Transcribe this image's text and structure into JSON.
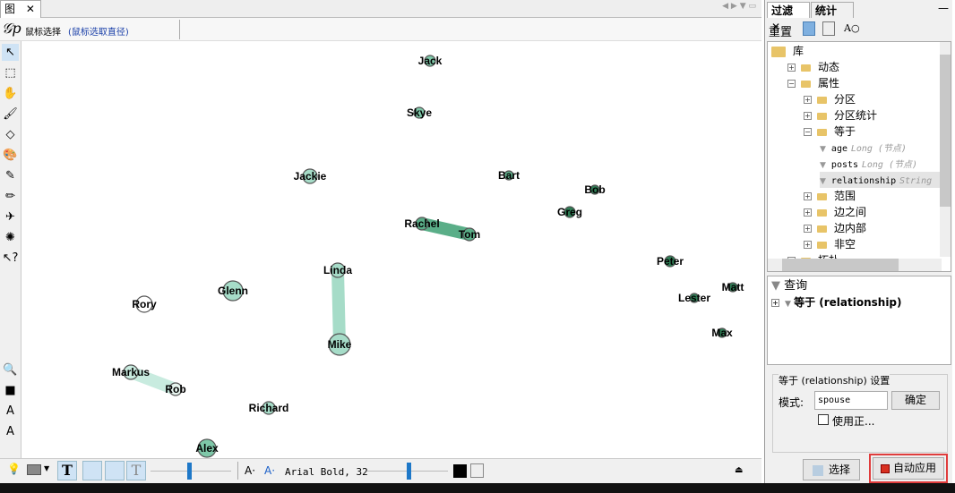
{
  "graph_tab": {
    "label": "图",
    "close": "✕"
  },
  "subtoolbar": {
    "mode": "鼠标选择",
    "hint": "(鼠标选取直径)"
  },
  "left_tools": [
    "pointer-icon",
    "rect-select-icon",
    "hand-icon",
    "brush-icon",
    "eraser-icon",
    "paint-icon",
    "pencil-icon",
    "highlighter-icon",
    "airplane-icon",
    "sun-icon",
    "help-pointer-icon"
  ],
  "left_tools_bottom": [
    "zoom-icon",
    "square-icon",
    "text-color-icon",
    "text-icon"
  ],
  "graph": {
    "nodes": [
      {
        "id": "Jack",
        "label": "Jack",
        "color": "#7ec7a8"
      },
      {
        "id": "Skye",
        "label": "Skye",
        "color": "#7ec7a8"
      },
      {
        "id": "Jackie",
        "label": "Jackie",
        "color": "#a6dcc8"
      },
      {
        "id": "Bart",
        "label": "Bart",
        "color": "#5fae8a"
      },
      {
        "id": "Bob",
        "label": "Bob",
        "color": "#2f7d55"
      },
      {
        "id": "Greg",
        "label": "Greg",
        "color": "#2f7d55"
      },
      {
        "id": "Rachel",
        "label": "Rachel",
        "color": "#5aae88"
      },
      {
        "id": "Tom",
        "label": "Tom",
        "color": "#5aae88"
      },
      {
        "id": "Linda",
        "label": "Linda",
        "color": "#a6dcc8"
      },
      {
        "id": "Mike",
        "label": "Mike",
        "color": "#a6dcc8"
      },
      {
        "id": "Glenn",
        "label": "Glenn",
        "color": "#a6dcc8"
      },
      {
        "id": "Rory",
        "label": "Rory",
        "color": "#ffffff"
      },
      {
        "id": "Markus",
        "label": "Markus",
        "color": "#c8ebdf"
      },
      {
        "id": "Rob",
        "label": "Rob",
        "color": "#e8f6f0"
      },
      {
        "id": "Richard",
        "label": "Richard",
        "color": "#a6dcc8"
      },
      {
        "id": "Alex",
        "label": "Alex",
        "color": "#7ec7a8"
      },
      {
        "id": "Peter",
        "label": "Peter",
        "color": "#2f7d55"
      },
      {
        "id": "Matt",
        "label": "Matt",
        "color": "#2f7d55"
      },
      {
        "id": "Lester",
        "label": "Lester",
        "color": "#2f7d55"
      },
      {
        "id": "Max",
        "label": "Max",
        "color": "#2f7d55"
      }
    ],
    "edges": [
      {
        "source": "Rachel",
        "target": "Tom",
        "color": "#5aae88"
      },
      {
        "source": "Linda",
        "target": "Mike",
        "color": "#a6dcc8"
      },
      {
        "source": "Markus",
        "target": "Rob",
        "color": "#c8ebdf"
      }
    ]
  },
  "bottombar": {
    "font": "Arial Bold, 32",
    "font_size_a": "A·",
    "font_color_a": "A·"
  },
  "right": {
    "tabs": [
      "过滤",
      "统计"
    ],
    "reset": "重置",
    "tree": [
      {
        "label": "库",
        "level": 0,
        "exp": ""
      },
      {
        "label": "动态",
        "level": 1,
        "exp": "+"
      },
      {
        "label": "属性",
        "level": 1,
        "exp": "−"
      },
      {
        "label": "分区",
        "level": 2,
        "exp": "+"
      },
      {
        "label": "分区统计",
        "level": 2,
        "exp": "+"
      },
      {
        "label": "等于",
        "level": 2,
        "exp": "−"
      },
      {
        "label": "age",
        "type": "Long (节点)",
        "level": 3,
        "leaf": true
      },
      {
        "label": "posts",
        "type": "Long (节点)",
        "level": 3,
        "leaf": true
      },
      {
        "label": "relationship",
        "type": "String",
        "level": 3,
        "leaf": true,
        "selected": true
      },
      {
        "label": "范围",
        "level": 2,
        "exp": "+"
      },
      {
        "label": "边之间",
        "level": 2,
        "exp": "+"
      },
      {
        "label": "边内部",
        "level": 2,
        "exp": "+"
      },
      {
        "label": "非空",
        "level": 2,
        "exp": "+"
      },
      {
        "label": "拓扑",
        "level": 1,
        "exp": "+"
      }
    ],
    "query_title": "查询",
    "query_item": "等于 (relationship)",
    "settings_title": "等于 (relationship) 设置",
    "pattern_label": "模式:",
    "pattern_value": "spouse",
    "ok": "确定",
    "use_regex": "使用正...",
    "select": "选择",
    "auto_apply": "自动应用",
    "highlight_color": "#e03c3c"
  }
}
